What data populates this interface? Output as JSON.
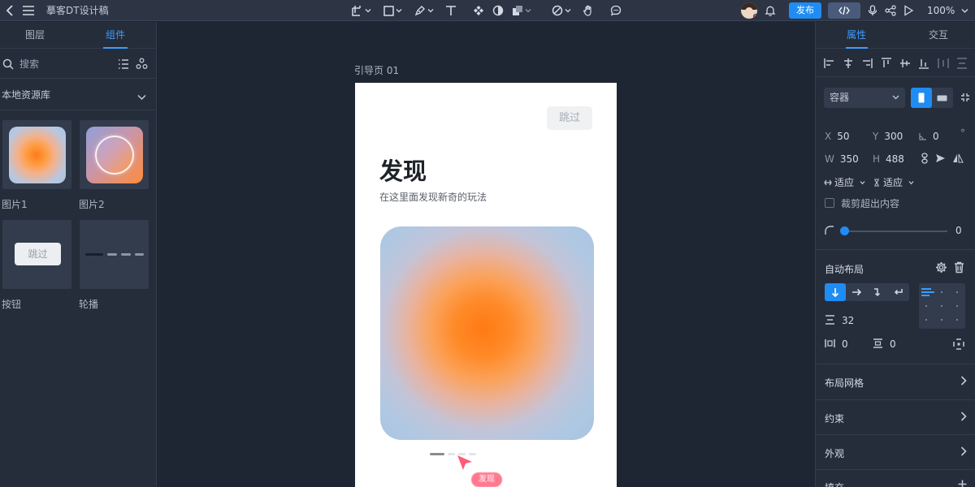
{
  "topbar": {
    "doc_title": "摹客DT设计稿",
    "publish_label": "发布",
    "zoom": "100%",
    "colors": {
      "accent": "#1f8cf3",
      "bg": "#2d3545"
    }
  },
  "left_panel": {
    "tabs": [
      {
        "label": "图层"
      },
      {
        "label": "组件"
      }
    ],
    "search_placeholder": "搜索",
    "library_label": "本地资源库",
    "assets": [
      {
        "label": "图片1"
      },
      {
        "label": "图片2"
      },
      {
        "label": "按钮"
      },
      {
        "label": "轮播"
      }
    ],
    "button_thumb_text": "跳过"
  },
  "canvas": {
    "frame_label": "引导页 01",
    "skip_label": "跳过",
    "heading": "发现",
    "subtitle": "在这里面发现新奇的玩法",
    "tooltip": "发现"
  },
  "right_panel": {
    "tabs": [
      {
        "label": "属性"
      },
      {
        "label": "交互"
      }
    ],
    "container_type": "容器",
    "x_label": "X",
    "x": "50",
    "y_label": "Y",
    "y": "300",
    "rotation": "0",
    "w_label": "W",
    "w": "350",
    "h_label": "H",
    "h": "488",
    "h_sizing": "适应",
    "v_sizing": "适应",
    "clip_label": "裁剪超出内容",
    "radius": "0",
    "auto_layout_title": "自动布局",
    "gap": "32",
    "padding_h": "0",
    "padding_v": "0",
    "sections": [
      {
        "label": "布局网格"
      },
      {
        "label": "约束"
      },
      {
        "label": "外观"
      },
      {
        "label": "填充"
      }
    ]
  }
}
